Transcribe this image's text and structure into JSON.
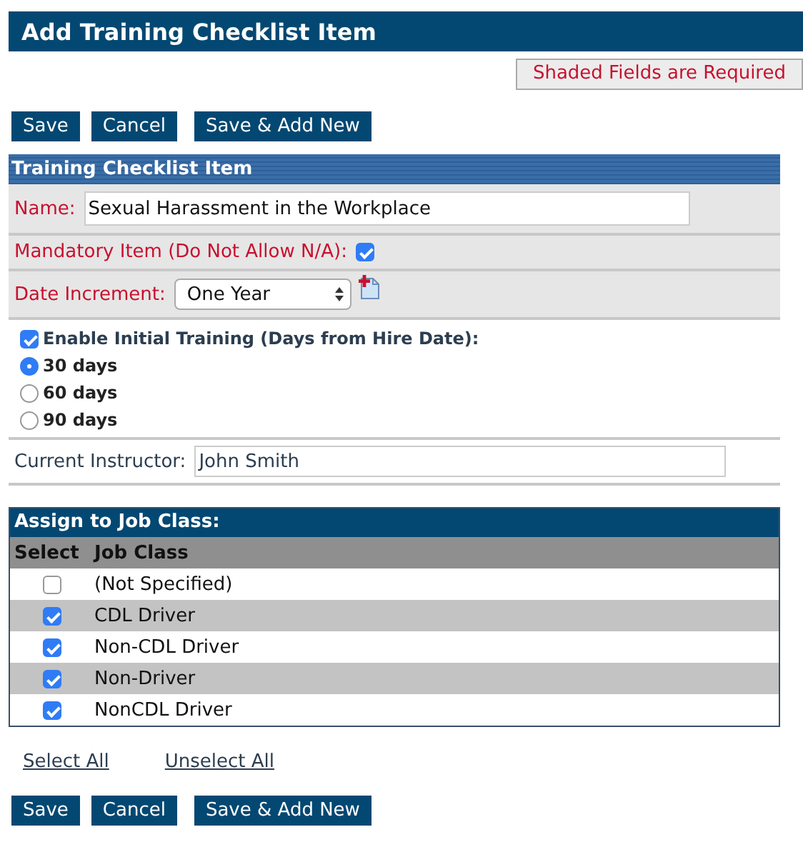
{
  "title": "Add Training Checklist Item",
  "required_note": "Shaded Fields are Required",
  "top_buttons": [
    "Save",
    "Cancel",
    "Save & Add New"
  ],
  "section": {
    "title": "Training Checklist Item",
    "name": {
      "label": "Name:",
      "value": "Sexual Harassment in the Workplace"
    },
    "mandatory": {
      "label": "Mandatory Item (Do Not Allow N/A):",
      "checked": true
    },
    "date_increment": {
      "label": "Date Increment:",
      "value": "One Year"
    },
    "initial_training": {
      "label": "Enable Initial Training (Days from Hire Date):",
      "checked": true,
      "options": [
        {
          "label": "30 days",
          "selected": true
        },
        {
          "label": "60 days",
          "selected": false
        },
        {
          "label": "90 days",
          "selected": false
        }
      ]
    },
    "instructor": {
      "label": "Current Instructor:",
      "value": "John Smith"
    }
  },
  "job_class": {
    "title": "Assign to Job Class:",
    "columns": [
      "Select",
      "Job Class"
    ],
    "rows": [
      {
        "name": "(Not Specified)",
        "checked": false
      },
      {
        "name": "CDL Driver",
        "checked": true
      },
      {
        "name": "Non-CDL Driver",
        "checked": true
      },
      {
        "name": "Non-Driver",
        "checked": true
      },
      {
        "name": "NonCDL Driver",
        "checked": true
      }
    ]
  },
  "links": [
    "Select All",
    "Unselect All"
  ],
  "bottom_buttons": [
    "Save",
    "Cancel",
    "Save & Add New"
  ]
}
